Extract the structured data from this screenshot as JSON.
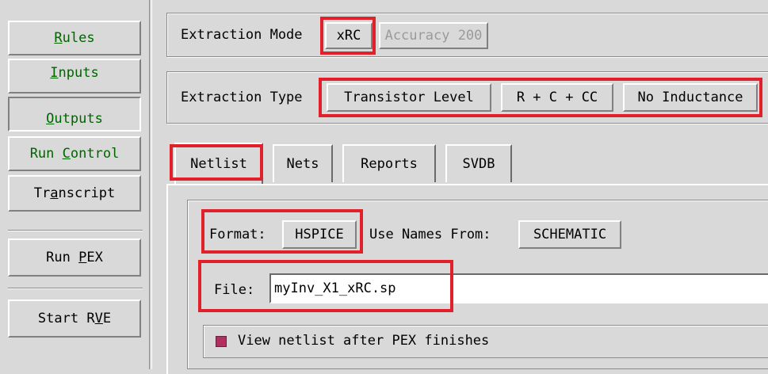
{
  "sidebar": {
    "rules": "Rules",
    "inputs": "Inputs",
    "outputs": "Outputs",
    "run_control": "Run Control",
    "transcript": "Transcript",
    "run_pex": "Run PEX",
    "start_rve": "Start RVE"
  },
  "extraction_mode": {
    "label": "Extraction Mode",
    "mode_button": "xRC",
    "accuracy_button": "Accuracy 200"
  },
  "extraction_type": {
    "label": "Extraction Type",
    "level_button": "Transistor Level",
    "rc_button": "R + C + CC",
    "inductance_button": "No Inductance"
  },
  "tabs": [
    "Netlist",
    "Nets",
    "Reports",
    "SVDB"
  ],
  "netlist": {
    "format_label": "Format:",
    "format_button": "HSPICE",
    "use_names_label": "Use Names From:",
    "use_names_button": "SCHEMATIC",
    "file_label": "File:",
    "file_value": "myInv_X1_xRC.sp",
    "view_checkbox_label": "View netlist after PEX finishes"
  },
  "colors": {
    "highlight_box": "#e0202a",
    "green_text": "#006400",
    "checkbox_fill": "#b03060"
  }
}
